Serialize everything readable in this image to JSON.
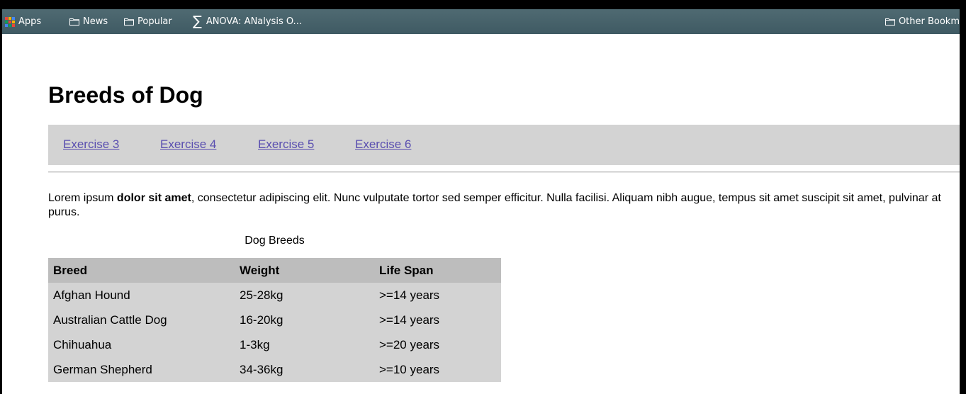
{
  "bookmarks": {
    "apps": "Apps",
    "news": "News",
    "popular": "Popular",
    "anova": "ANOVA: ANalysis O...",
    "other": "Other Bookm"
  },
  "page": {
    "title": "Breeds of Dog",
    "nav": [
      "Exercise 3",
      "Exercise 4",
      "Exercise 5",
      "Exercise 6"
    ],
    "paragraph": {
      "before": "Lorem ipsum ",
      "bold": "dolor sit amet",
      "after": ", consectetur adipiscing elit. Nunc vulputate tortor sed semper efficitur. Nulla facilisi. Aliquam nibh augue, tempus sit amet suscipit sit amet, pulvinar at purus."
    }
  },
  "table": {
    "caption": "Dog Breeds",
    "headers": [
      "Breed",
      "Weight",
      "Life Span"
    ],
    "rows": [
      [
        "Afghan Hound",
        "25-28kg",
        ">=14 years"
      ],
      [
        "Australian Cattle Dog",
        "16-20kg",
        ">=14 years"
      ],
      [
        "Chihuahua",
        "1-3kg",
        ">=20 years"
      ],
      [
        "German Shepherd",
        "34-36kg",
        ">=10 years"
      ]
    ]
  },
  "colors": {
    "bookmark_bar": "#46616a",
    "nav_background": "#d3d3d3",
    "link": "#5a4fb0",
    "table_header": "#bdbdbd",
    "table_body": "#d3d3d3"
  }
}
